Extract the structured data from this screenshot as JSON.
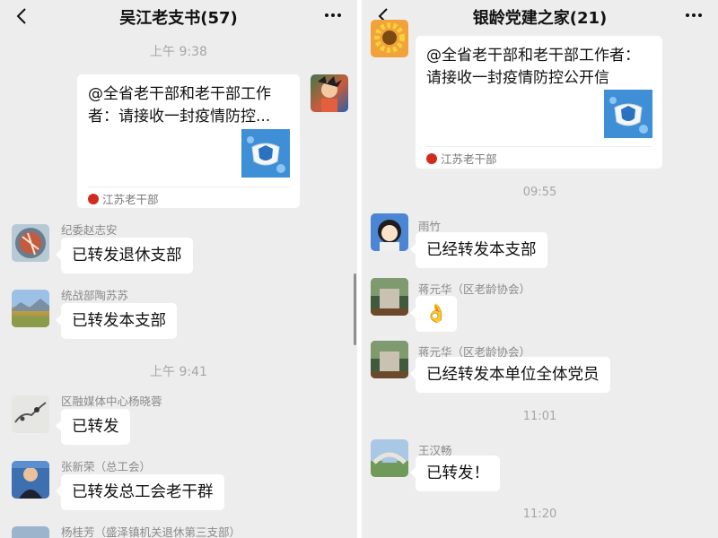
{
  "left": {
    "title": "吴江老支书(57)",
    "messages": [
      {
        "type": "time",
        "text": "上午 9:38"
      },
      {
        "type": "card",
        "text_line1": "@全省老干部和老干部工作",
        "text_line2": "者：请接收一封疫情防控...",
        "source": "江苏老干部"
      },
      {
        "type": "text",
        "name": "纪委赵志安",
        "text": "已转发退休支部"
      },
      {
        "type": "text",
        "name": "统战部陶苏苏",
        "text": "已转发本支部"
      },
      {
        "type": "time",
        "text": "上午 9:41"
      },
      {
        "type": "text",
        "name": "区融媒体中心杨晓蓉",
        "text": "已转发"
      },
      {
        "type": "text",
        "name": "张新荣（总工会）",
        "text": "已转发总工会老干群"
      },
      {
        "type": "text",
        "name": "杨桂芳（盛泽镇机关退休第三支部）",
        "text": ""
      }
    ]
  },
  "right": {
    "title": "银龄党建之家(21)",
    "messages": [
      {
        "type": "card",
        "text_line1": "@全省老干部和老干部工作者：",
        "text_line2": "请接收一封疫情防控公开信",
        "source": "江苏老干部"
      },
      {
        "type": "time",
        "text": "09:55"
      },
      {
        "type": "text",
        "name": "雨竹",
        "text": "已经转发本支部"
      },
      {
        "type": "emoji",
        "name": "蒋元华（区老龄协会）",
        "emoji": "👌"
      },
      {
        "type": "text",
        "name": "蒋元华（区老龄协会）",
        "text": "已经转发本单位全体党员"
      },
      {
        "type": "time",
        "text": "11:01"
      },
      {
        "type": "text",
        "name": "王汉畅",
        "text": "已转发！"
      },
      {
        "type": "time",
        "text": "11:20"
      }
    ]
  },
  "colors": {
    "background": "#ededed",
    "bubble": "#ffffff",
    "timestamp": "#a6a6a6",
    "source_logo": "#d12b1e"
  },
  "icons": {
    "back": "chevron-left-icon",
    "more": "more-dots-icon",
    "mask": "mask-shield-thumbnail"
  }
}
